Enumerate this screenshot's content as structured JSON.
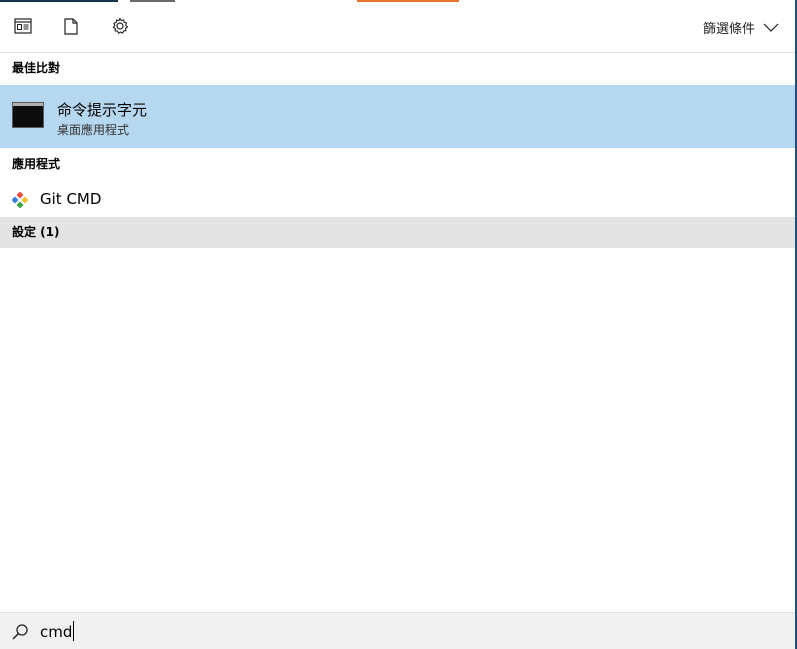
{
  "toolbar": {
    "icons": [
      "all-apps-icon",
      "documents-icon",
      "settings-gear-icon"
    ],
    "filter_label": "篩選條件"
  },
  "best_match": {
    "header": "最佳比對",
    "item": {
      "title": "命令提示字元",
      "subtitle": "桌面應用程式",
      "icon": "cmd-console-icon"
    }
  },
  "apps": {
    "header": "應用程式",
    "items": [
      {
        "label": "Git CMD",
        "icon": "git-icon"
      }
    ]
  },
  "settings": {
    "label": "設定 (1)"
  },
  "search": {
    "value": "cmd",
    "icon": "search-icon"
  },
  "colors": {
    "selected_bg": "#b6d7f0",
    "section_bg": "#e4e4e4",
    "search_bg": "#f0f0f0"
  }
}
